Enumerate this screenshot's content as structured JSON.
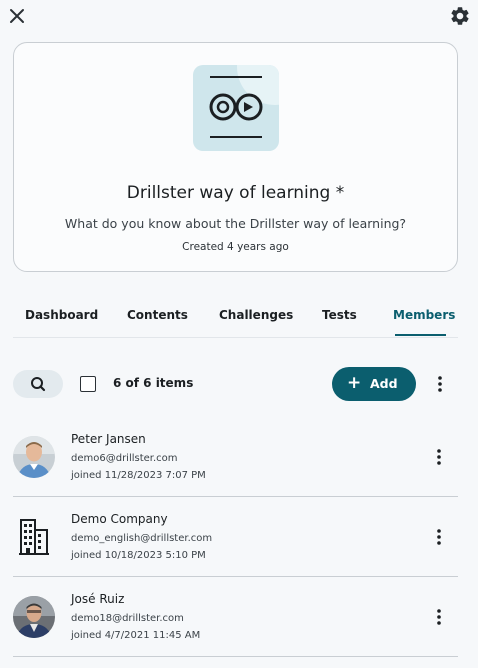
{
  "header": {
    "close_icon": "close-icon",
    "settings_icon": "gear-icon"
  },
  "course": {
    "logo_icon": "drillster-logo-icon",
    "title": "Drillster way of learning *",
    "description": "What do you know about the Drillster way of learning?",
    "created": "Created 4 years ago"
  },
  "tabs": [
    {
      "label": "Dashboard",
      "active": false
    },
    {
      "label": "Contents",
      "active": false
    },
    {
      "label": "Challenges",
      "active": false
    },
    {
      "label": "Tests",
      "active": false
    },
    {
      "label": "Members",
      "active": true
    }
  ],
  "toolbar": {
    "search_icon": "search-icon",
    "item_count": "6 of 6 items",
    "add_label": "Add",
    "add_icon": "plus-icon",
    "more_icon": "more-vertical-icon"
  },
  "members": [
    {
      "name": "Peter Jansen",
      "email": "demo6@drillster.com",
      "joined": "joined 11/28/2023 7:07 PM",
      "avatar": "person-photo"
    },
    {
      "name": "Demo Company",
      "email": "demo_english@drillster.com",
      "joined": "joined 10/18/2023 5:10 PM",
      "avatar": "building-icon"
    },
    {
      "name": "José Ruiz",
      "email": "demo18@drillster.com",
      "joined": "joined 4/7/2021 11:45 AM",
      "avatar": "person-photo"
    }
  ],
  "colors": {
    "accent": "#0b5e6e",
    "background": "#f6f8fa",
    "card_border": "#c9ced3",
    "logo_bg": "#cfe6ec"
  }
}
